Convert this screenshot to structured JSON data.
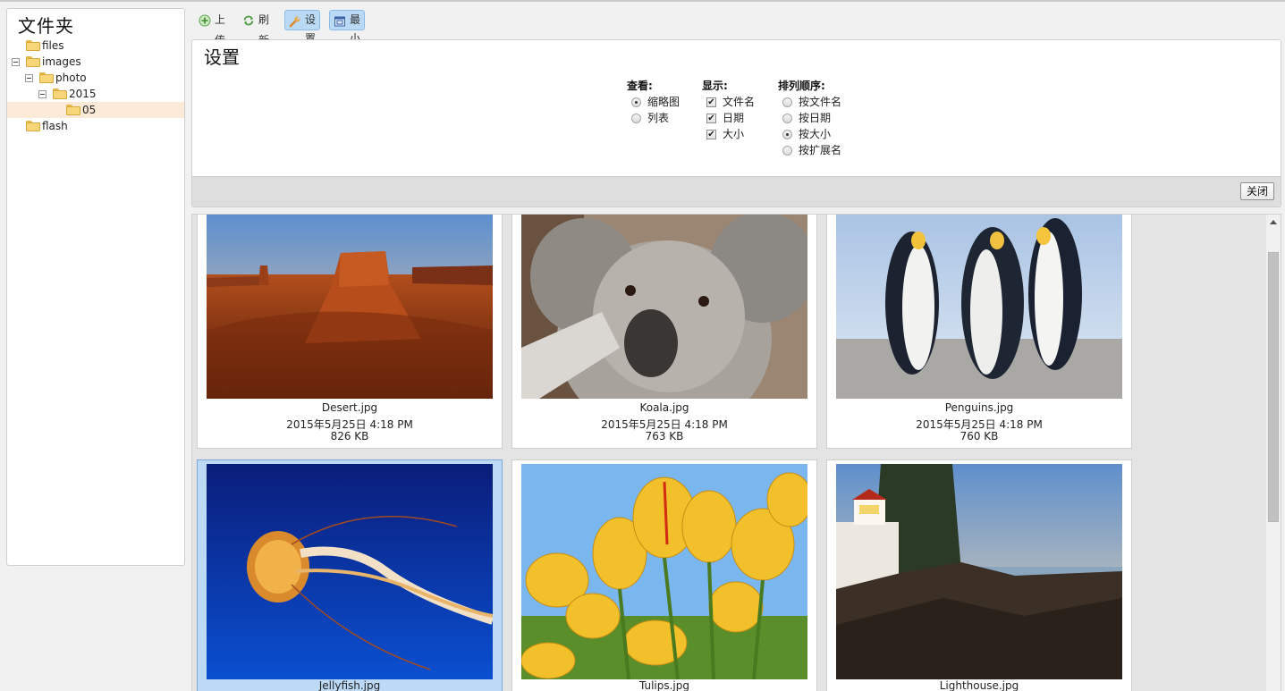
{
  "sidebar": {
    "title": "文件夹",
    "tree": [
      {
        "label": "files"
      },
      {
        "label": "images"
      },
      {
        "label": "photo"
      },
      {
        "label": "2015"
      },
      {
        "label": "05"
      },
      {
        "label": "flash"
      }
    ]
  },
  "toolbar": {
    "upload_label": "上传",
    "refresh_label": "刷新",
    "settings_label": "设置",
    "minimize_label": "最小化"
  },
  "settings": {
    "title": "设置",
    "view": {
      "title": "查看:",
      "options": [
        "缩略图",
        "列表"
      ],
      "selected": "缩略图"
    },
    "display": {
      "title": "显示:",
      "options": [
        "文件名",
        "日期",
        "大小"
      ],
      "checked": [
        "文件名",
        "日期",
        "大小"
      ]
    },
    "sort": {
      "title": "排列顺序:",
      "options": [
        "按文件名",
        "按日期",
        "按大小",
        "按扩展名"
      ],
      "selected": "按大小"
    },
    "close_label": "关闭"
  },
  "files": [
    {
      "name": "Desert.jpg",
      "date": "2015年5月25日 4:18 PM",
      "size": "826 KB"
    },
    {
      "name": "Koala.jpg",
      "date": "2015年5月25日 4:18 PM",
      "size": "763 KB"
    },
    {
      "name": "Penguins.jpg",
      "date": "2015年5月25日 4:18 PM",
      "size": "760 KB"
    },
    {
      "name": "Jellyfish.jpg"
    },
    {
      "name": "Tulips.jpg"
    },
    {
      "name": "Lighthouse.jpg"
    }
  ],
  "selected_tree_item": "05",
  "selected_file": "Jellyfish.jpg",
  "colors": {
    "selection_blue": "#bcdaf6",
    "tree_selection": "#fbead7",
    "toolbar_active": "#b9d9f4"
  }
}
